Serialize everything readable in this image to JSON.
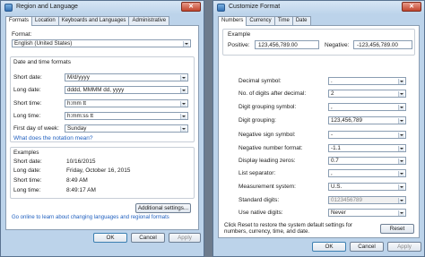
{
  "region_window": {
    "title": "Region and Language",
    "tabs": [
      "Formats",
      "Location",
      "Keyboards and Languages",
      "Administrative"
    ],
    "format_label": "Format:",
    "format_value": "English (United States)",
    "date_time_header": "Date and time formats",
    "rows": [
      {
        "label": "Short date:",
        "value": "M/d/yyyy"
      },
      {
        "label": "Long date:",
        "value": "dddd, MMMM dd, yyyy"
      },
      {
        "label": "Short time:",
        "value": "h:mm tt"
      },
      {
        "label": "Long time:",
        "value": "h:mm:ss tt"
      },
      {
        "label": "First day of week:",
        "value": "Sunday"
      }
    ],
    "notation_link": "What does the notation mean?",
    "examples_header": "Examples",
    "examples": [
      {
        "label": "Short date:",
        "value": "10/16/2015"
      },
      {
        "label": "Long date:",
        "value": "Friday, October 16, 2015"
      },
      {
        "label": "Short time:",
        "value": "8:49 AM"
      },
      {
        "label": "Long time:",
        "value": "8:49:17 AM"
      }
    ],
    "additional_settings_button": "Additional settings...",
    "online_link": "Go online to learn about changing languages and regional formats",
    "ok_button": "OK",
    "cancel_button": "Cancel",
    "apply_button": "Apply"
  },
  "customize_window": {
    "title": "Customize Format",
    "tabs": [
      "Numbers",
      "Currency",
      "Time",
      "Date"
    ],
    "example_header": "Example",
    "positive_label": "Positive:",
    "positive_value": "123,456,789.00",
    "negative_label": "Negative:",
    "negative_value": "-123,456,789.00",
    "settings": [
      {
        "label": "Decimal symbol:",
        "value": "."
      },
      {
        "label": "No. of digits after decimal:",
        "value": "2"
      },
      {
        "label": "Digit grouping symbol:",
        "value": ","
      },
      {
        "label": "Digit grouping:",
        "value": "123,456,789"
      },
      {
        "label": "Negative sign symbol:",
        "value": "-"
      },
      {
        "label": "Negative number format:",
        "value": "-1.1"
      },
      {
        "label": "Display leading zeros:",
        "value": "0.7"
      },
      {
        "label": "List separator:",
        "value": ","
      },
      {
        "label": "Measurement system:",
        "value": "U.S."
      },
      {
        "label": "Standard digits:",
        "value": "0123456789"
      },
      {
        "label": "Use native digits:",
        "value": "Never"
      }
    ],
    "reset_text": "Click Reset to restore the system default settings for numbers, currency, time, and date.",
    "reset_button": "Reset",
    "ok_button": "OK",
    "cancel_button": "Cancel",
    "apply_button": "Apply"
  }
}
